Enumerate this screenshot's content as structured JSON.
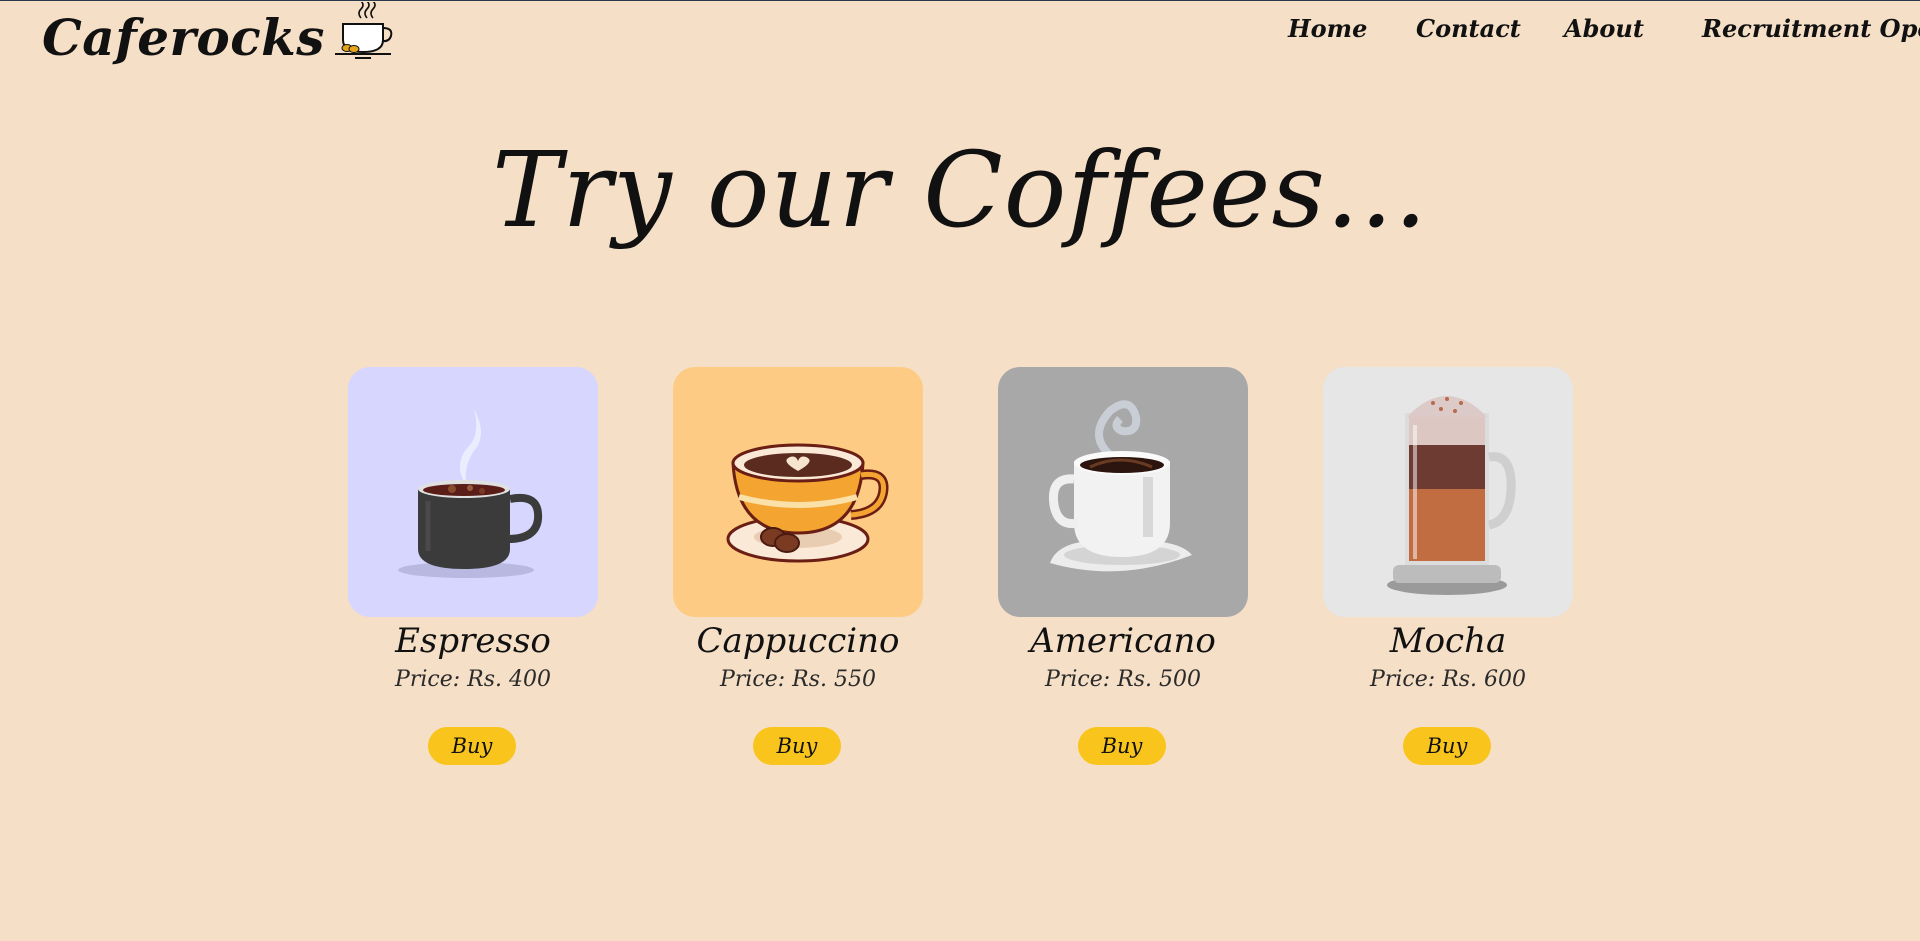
{
  "header": {
    "brand": "Caferocks",
    "nav": [
      {
        "label": "Home"
      },
      {
        "label": "Contact"
      },
      {
        "label": "About"
      },
      {
        "label": "Recruitment Open"
      }
    ]
  },
  "hero": {
    "title": "Try our Coffees..."
  },
  "products": [
    {
      "name": "Espresso",
      "price": "Price: Rs. 400",
      "buy_label": "Buy",
      "bg": "#d6d6ff",
      "icon": "espresso-mug-icon"
    },
    {
      "name": "Cappuccino",
      "price": "Price: Rs. 550",
      "buy_label": "Buy",
      "bg": "#fecb84",
      "icon": "cappuccino-cup-icon"
    },
    {
      "name": "Americano",
      "price": "Price: Rs. 500",
      "buy_label": "Buy",
      "bg": "#a8a8a8",
      "icon": "americano-cup-icon"
    },
    {
      "name": "Mocha",
      "price": "Price: Rs. 600",
      "buy_label": "Buy",
      "bg": "#e6e6e6",
      "icon": "mocha-glass-icon"
    }
  ],
  "colors": {
    "page_bg": "#f5dfc7",
    "button": "#f9c51c"
  }
}
